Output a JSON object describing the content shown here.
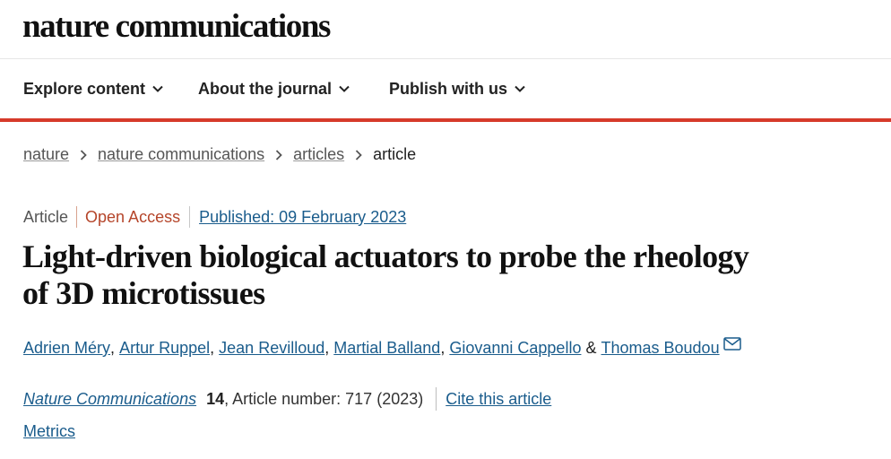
{
  "brand": "nature communications",
  "nav": [
    {
      "label": "Explore content"
    },
    {
      "label": "About the journal"
    },
    {
      "label": "Publish with us"
    }
  ],
  "breadcrumb": [
    "nature",
    "nature communications",
    "articles",
    "article"
  ],
  "meta": {
    "type": "Article",
    "access": "Open Access",
    "published": "Published: 09 February 2023"
  },
  "title": "Light-driven biological actuators to probe the rheology of 3D microtissues",
  "authors": [
    "Adrien Méry",
    "Artur Ruppel",
    "Jean Revilloud",
    "Martial Balland",
    "Giovanni Cappello",
    "Thomas Boudou"
  ],
  "author_sep": ",",
  "author_last_join": "&",
  "citation": {
    "journal": "Nature Communications",
    "volume": "14",
    "rest": ", Article number: 717 (2023)",
    "cite_label": "Cite this article"
  },
  "metrics_label": "Metrics",
  "colors": {
    "accent_red": "#d63a2a",
    "link_blue": "#1a5c8c",
    "open_access": "#b5452a"
  },
  "icons": [
    "chevron-down-icon",
    "chevron-right-icon",
    "mail-icon"
  ]
}
